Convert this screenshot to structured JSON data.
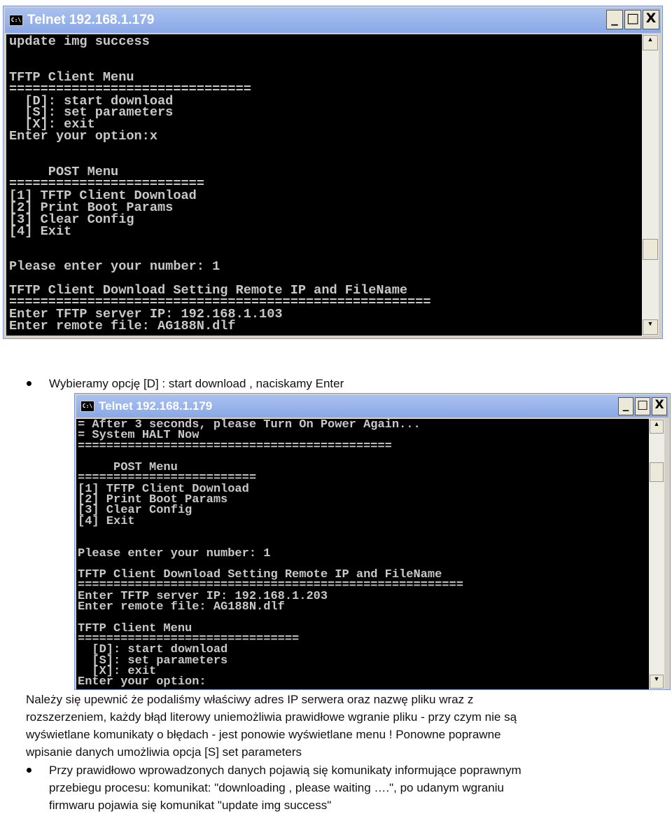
{
  "window1": {
    "title": "Telnet 192.168.1.179",
    "icon": "C:\\",
    "lines": [
      "update img success",
      "",
      "",
      "TFTP Client Menu",
      "===============================",
      "  [D]: start download",
      "  [S]: set parameters",
      "  [X]: exit",
      "Enter your option:x",
      "",
      "",
      "     POST Menu",
      "=========================",
      "[1] TFTP Client Download",
      "[2] Print Boot Params",
      "[3] Clear Config",
      "[4] Exit",
      "",
      "",
      "Please enter your number: 1",
      "",
      "TFTP Client Download Setting Remote IP and FileName",
      "======================================================",
      "Enter TFTP server IP: 192.168.1.103",
      "Enter remote file: AG188N.dlf"
    ]
  },
  "bullet1": "Wybieramy opcję [D] : start download , naciskamy Enter",
  "window2": {
    "title": "Telnet 192.168.1.179",
    "icon": "C:\\",
    "lines": [
      "= After 3 seconds, please Turn On Power Again...",
      "= System HALT Now",
      "============================================",
      "",
      "     POST Menu",
      "=========================",
      "[1] TFTP Client Download",
      "[2] Print Boot Params",
      "[3] Clear Config",
      "[4] Exit",
      "",
      "",
      "Please enter your number: 1",
      "",
      "TFTP Client Download Setting Remote IP and FileName",
      "======================================================",
      "Enter TFTP server IP: 192.168.1.203",
      "Enter remote file: AG188N.dlf",
      "",
      "TFTP Client Menu",
      "===============================",
      "  [D]: start download",
      "  [S]: set parameters",
      "  [X]: exit",
      "Enter your option:"
    ]
  },
  "paragraph": [
    "Należy się upewnić że podaliśmy właściwy adres IP serwera oraz nazwę pliku wraz z",
    "rozszerzeniem, każdy błąd literowy uniemożliwia prawidłowe wgranie pliku  - przy czym nie są",
    "wyświetlane komunikaty o błędach  - jest ponowie wyświetlane menu ! Ponowne poprawne",
    "wpisanie danych umożliwia opcja [S] set parameters"
  ],
  "bullet2": [
    "Przy prawidłowo wprowadzonych danych pojawią się komunikaty informujące  poprawnym",
    "przebiegu procesu:      komunikat: \"downloading , please waiting ….\", po udanym wgraniu",
    "firmwaru pojawia się komunikat  \"update img success\""
  ]
}
